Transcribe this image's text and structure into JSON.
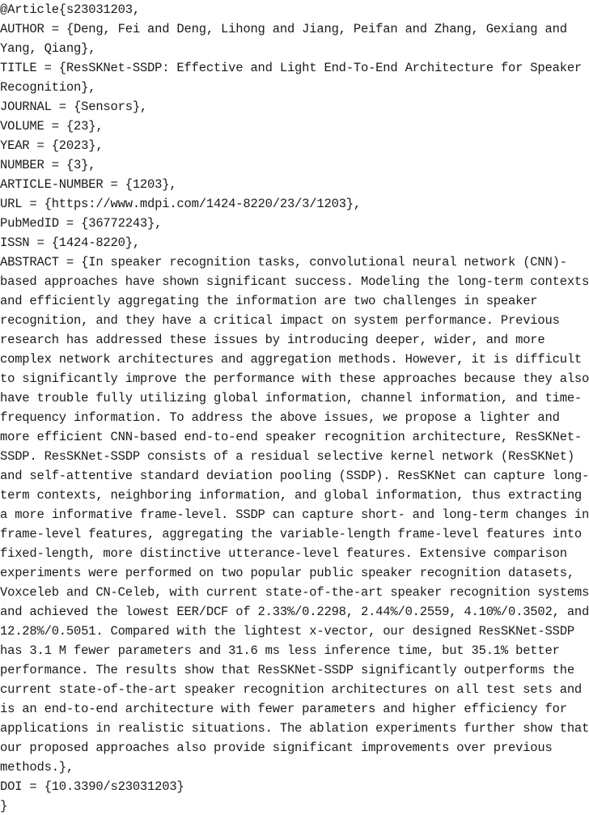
{
  "bibtex": {
    "lines": [
      "@Article{s23031203,",
      "AUTHOR = {Deng, Fei and Deng, Lihong and Jiang, Peifan and Zhang, Gexiang and",
      "Yang, Qiang},",
      "TITLE = {ResSKNet-SSDP: Effective and Light End-To-End Architecture for Speaker",
      "Recognition},",
      "JOURNAL = {Sensors},",
      "VOLUME = {23},",
      "YEAR = {2023},",
      "NUMBER = {3},",
      "ARTICLE-NUMBER = {1203},",
      "URL = {https://www.mdpi.com/1424-8220/23/3/1203},",
      "PubMedID = {36772243},",
      "ISSN = {1424-8220},",
      "ABSTRACT = {In speaker recognition tasks, convolutional neural network (CNN)-",
      "based approaches have shown significant success. Modeling the long-term contexts",
      "and efficiently aggregating the information are two challenges in speaker",
      "recognition, and they have a critical impact on system performance. Previous",
      "research has addressed these issues by introducing deeper, wider, and more",
      "complex network architectures and aggregation methods. However, it is difficult",
      "to significantly improve the performance with these approaches because they also",
      "have trouble fully utilizing global information, channel information, and time-",
      "frequency information. To address the above issues, we propose a lighter and",
      "more efficient CNN-based end-to-end speaker recognition architecture, ResSKNet-",
      "SSDP. ResSKNet-SSDP consists of a residual selective kernel network (ResSKNet)",
      "and self-attentive standard deviation pooling (SSDP). ResSKNet can capture long-",
      "term contexts, neighboring information, and global information, thus extracting",
      "a more informative frame-level. SSDP can capture short- and long-term changes in",
      "frame-level features, aggregating the variable-length frame-level features into",
      "fixed-length, more distinctive utterance-level features. Extensive comparison",
      "experiments were performed on two popular public speaker recognition datasets,",
      "Voxceleb and CN-Celeb, with current state-of-the-art speaker recognition systems",
      "and achieved the lowest EER/DCF of 2.33%/0.2298, 2.44%/0.2559, 4.10%/0.3502, and",
      "12.28%/0.5051. Compared with the lightest x-vector, our designed ResSKNet-SSDP",
      "has 3.1 M fewer parameters and 31.6 ms less inference time, but 35.1% better",
      "performance. The results show that ResSKNet-SSDP significantly outperforms the",
      "current state-of-the-art speaker recognition architectures on all test sets and",
      "is an end-to-end architecture with fewer parameters and higher efficiency for",
      "applications in realistic situations. The ablation experiments further show that",
      "our proposed approaches also provide significant improvements over previous",
      "methods.},",
      "DOI = {10.3390/s23031203}",
      "}"
    ]
  }
}
